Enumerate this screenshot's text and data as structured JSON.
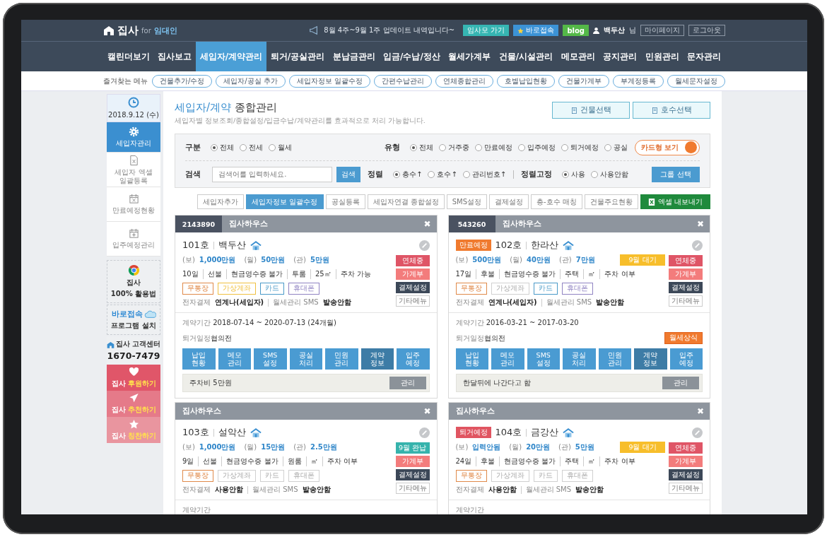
{
  "header": {
    "logo": "집사",
    "logo_for": "for",
    "logo_sub": "임대인",
    "notice": "8월 4주~9월 1주 업데이트 내역입니다~",
    "links": [
      {
        "label": "임사모 가기",
        "kind": "teal"
      },
      {
        "label": "바로접속",
        "kind": "star"
      },
      {
        "label": "blog",
        "kind": "blog"
      }
    ],
    "user": "백두산",
    "user_suffix": "님",
    "account_links": [
      "마이페이지",
      "로그아웃"
    ]
  },
  "nav": [
    {
      "label": "캘린더보기",
      "selected": false
    },
    {
      "label": "집사보고",
      "selected": false
    },
    {
      "label": "세입자/계약관리",
      "selected": true
    },
    {
      "label": "퇴거/공실관리",
      "selected": false
    },
    {
      "label": "분납금관리",
      "selected": false
    },
    {
      "label": "입금/수납/정산",
      "selected": false
    },
    {
      "label": "월세가계부",
      "selected": false
    },
    {
      "label": "건물/시설관리",
      "selected": false
    },
    {
      "label": "메모관리",
      "selected": false
    },
    {
      "label": "공지관리",
      "selected": false
    },
    {
      "label": "민원관리",
      "selected": false
    },
    {
      "label": "문자관리",
      "selected": false
    }
  ],
  "favorites": {
    "label": "즐겨찾는 메뉴",
    "items": [
      "건물추가/수정",
      "세입자/공실 추가",
      "세입자정보 일괄수정",
      "간편수납관리",
      "연체종합관리",
      "호별납입현황",
      "건물가계부",
      "부계정등록",
      "월세문자설정"
    ]
  },
  "sidebar": {
    "date": "2018.9.12 (수)",
    "menu": [
      {
        "label": "세입자관리",
        "kind": "gear",
        "selected": true
      },
      {
        "label": "세입자 엑셀 일괄등록",
        "kind": "excel",
        "selected": false
      },
      {
        "label": "만료예정현황",
        "kind": "cal-x",
        "selected": false
      },
      {
        "label": "입주예정관리",
        "kind": "cal-plus",
        "selected": false
      }
    ],
    "guide": {
      "title": "집사",
      "subtitle": "100% 활용법"
    },
    "install": {
      "title": "바로접속",
      "subtitle": "프로그램 설치"
    },
    "support": {
      "title": "집사 고객센터",
      "phone": "1670-7479"
    },
    "actions": [
      {
        "prefix": "집사",
        "label": "후원하기",
        "kind": "heart"
      },
      {
        "prefix": "집사",
        "label": "추천하기",
        "kind": "plane"
      },
      {
        "prefix": "집사",
        "label": "칭찬하기",
        "kind": "star"
      }
    ]
  },
  "page": {
    "title": "세입자/계약",
    "title_rest": "종합관리",
    "subtitle": "세입자별 정보조회/종합설정/입금수납/계약관리를 효과적으로 처리 가능합니다.",
    "top_buttons": [
      "건물선택",
      "호수선택"
    ]
  },
  "filters": {
    "division": {
      "label": "구분",
      "options": [
        {
          "label": "전체",
          "selected": true
        },
        {
          "label": "전세",
          "selected": false
        },
        {
          "label": "월세",
          "selected": false
        }
      ]
    },
    "type": {
      "label": "유형",
      "options": [
        {
          "label": "전체",
          "selected": true
        },
        {
          "label": "거주중",
          "selected": false
        },
        {
          "label": "만료예정",
          "selected": false
        },
        {
          "label": "입주예정",
          "selected": false
        },
        {
          "label": "퇴거예정",
          "selected": false
        },
        {
          "label": "공실",
          "selected": false
        }
      ]
    },
    "view_toggle": {
      "label": "카드형 보기",
      "on": true
    },
    "search": {
      "label": "검색",
      "placeholder": "검색어를 입력하세요.",
      "button": "검색"
    },
    "sort": {
      "label": "정렬",
      "options": [
        {
          "label": "층수↑",
          "selected": true
        },
        {
          "label": "호수↑",
          "selected": false
        },
        {
          "label": "관리번호↑",
          "selected": false
        }
      ]
    },
    "sort_fixed": {
      "label": "정렬고정",
      "options": [
        {
          "label": "사용",
          "selected": true
        },
        {
          "label": "사용안함",
          "selected": false
        }
      ]
    },
    "group_button": "그룹 선택"
  },
  "toolbar": [
    {
      "label": "세입자추가",
      "kind": "plain"
    },
    {
      "label": "세입자정보 일괄수정",
      "kind": "primary"
    },
    {
      "label": "공실등록",
      "kind": "plain"
    },
    {
      "label": "세입자연결 종합설정",
      "kind": "plain"
    },
    {
      "label": "SMS설정",
      "kind": "plain"
    },
    {
      "label": "결제설정",
      "kind": "plain"
    },
    {
      "label": "층-호수 매칭",
      "kind": "plain"
    },
    {
      "label": "건물주요현황",
      "kind": "plain"
    },
    {
      "label": "엑셀 내보내기",
      "kind": "excel"
    }
  ],
  "cards": [
    {
      "id": "2143890",
      "building": "집사하우스",
      "close": "✖",
      "unit": "101호",
      "tenant": "백두산",
      "money": [
        {
          "label": "(보)",
          "value": "1,000만원"
        },
        {
          "label": "(월)",
          "value": "50만원"
        },
        {
          "label": "(관)",
          "value": "5만원"
        }
      ],
      "details": [
        "10일",
        "선불",
        "현금영수증 불가",
        "투룸",
        "25㎡",
        "주차 가능"
      ],
      "pay_methods": [
        {
          "label": "무통장",
          "on": true,
          "color": "#e08a4a"
        },
        {
          "label": "가상계좌",
          "on": true,
          "color": "#f0c040"
        },
        {
          "label": "카드",
          "on": true,
          "color": "#4a9ac8"
        },
        {
          "label": "휴대폰",
          "on": true,
          "color": "#9083c2"
        }
      ],
      "epay": {
        "label": "전자결제",
        "value": "연계나(세입자)",
        "sms_label": "월세관리 SMS",
        "sms_value": "발송안함"
      },
      "side_buttons": [
        {
          "label": "연체중",
          "kind": "overdue"
        },
        {
          "label": "가계부",
          "kind": "ledger"
        },
        {
          "label": "결제설정",
          "kind": "settings"
        },
        {
          "label": "기타메뉴",
          "kind": "etc"
        }
      ],
      "contract": {
        "label": "계약기간",
        "value": "2018-07-14 ~ 2020-07-13 (24개월)"
      },
      "moveout": {
        "label": "퇴거일정",
        "value": "협의전"
      },
      "tabs": [
        {
          "label": "납입\n현황",
          "selected": false
        },
        {
          "label": "메모\n관리",
          "selected": false
        },
        {
          "label": "SMS\n설정",
          "selected": false
        },
        {
          "label": "공실\n처리",
          "selected": false
        },
        {
          "label": "민원\n관리",
          "selected": false
        },
        {
          "label": "계약\n정보",
          "selected": true
        },
        {
          "label": "입주\n예정",
          "selected": false
        }
      ],
      "memo": {
        "text": "주차비 5만원",
        "button": "관리"
      }
    },
    {
      "id": "543260",
      "building": "집사하우스",
      "close": "✖",
      "status": {
        "label": "만료예정",
        "color": "#f07a2e"
      },
      "unit": "102호",
      "tenant": "한라산",
      "money": [
        {
          "label": "(보)",
          "value": "500만원"
        },
        {
          "label": "(월)",
          "value": "40만원"
        },
        {
          "label": "(관)",
          "value": "7만원"
        }
      ],
      "badges": [
        {
          "label": "9월 대기",
          "kind": "waiting"
        }
      ],
      "details": [
        "17일",
        "후불",
        "현금영수증 불가",
        "주택",
        "㎡",
        "주차 여부"
      ],
      "pay_methods": [
        {
          "label": "무통장",
          "on": true,
          "color": "#e08a4a"
        },
        {
          "label": "가상계좌",
          "on": false
        },
        {
          "label": "카드",
          "on": true,
          "color": "#4a9ac8"
        },
        {
          "label": "휴대폰",
          "on": true,
          "color": "#9083c2"
        }
      ],
      "epay": {
        "label": "전자결제",
        "value": "연계나(세입자)",
        "sms_label": "월세관리 SMS",
        "sms_value": "발송안함"
      },
      "side_buttons": [
        {
          "label": "연체중",
          "kind": "overdue"
        },
        {
          "label": "가계부",
          "kind": "ledger"
        },
        {
          "label": "결제설정",
          "kind": "settings"
        },
        {
          "label": "기타메뉴",
          "kind": "etc"
        }
      ],
      "contract": {
        "label": "계약기간",
        "value": "2016-03-21 ~ 2017-03-20"
      },
      "moveout": {
        "label": "퇴거일정",
        "value": "협의전",
        "button": "월세상식"
      },
      "tabs": [
        {
          "label": "납입\n현황",
          "selected": false
        },
        {
          "label": "메모\n관리",
          "selected": false
        },
        {
          "label": "SMS\n설정",
          "selected": false
        },
        {
          "label": "공실\n처리",
          "selected": false
        },
        {
          "label": "민원\n관리",
          "selected": false
        },
        {
          "label": "계약\n정보",
          "selected": true
        },
        {
          "label": "입주\n예정",
          "selected": false
        }
      ],
      "memo": {
        "text": "한달뒤에 나간다고 함",
        "button": "관리"
      }
    },
    {
      "building": "집사하우스",
      "close": "✖",
      "unit": "103호",
      "tenant": "설악산",
      "money": [
        {
          "label": "(보)",
          "value": "1,000만원"
        },
        {
          "label": "(월)",
          "value": "15만원"
        },
        {
          "label": "(관)",
          "value": "2.5만원"
        }
      ],
      "details": [
        "9일",
        "선불",
        "현금영수증 불가",
        "원룸",
        "㎡",
        "주차 여부"
      ],
      "pay_methods": [
        {
          "label": "무통장",
          "on": true,
          "color": "#e08a4a"
        },
        {
          "label": "가상계좌",
          "on": false
        },
        {
          "label": "카드",
          "on": false
        },
        {
          "label": "휴대폰",
          "on": false
        }
      ],
      "epay": {
        "label": "전자결제",
        "value": "사용안함",
        "sms_label": "월세관리 SMS",
        "sms_value": "발송안함"
      },
      "side_buttons": [
        {
          "label": "9월 완납",
          "kind": "paid"
        },
        {
          "label": "가계부",
          "kind": "ledger"
        },
        {
          "label": "결제설정",
          "kind": "settings"
        },
        {
          "label": "기타메뉴",
          "kind": "etc"
        }
      ],
      "contract": {
        "label": "계약기간"
      }
    },
    {
      "building": "집사하우스",
      "close": "✖",
      "status": {
        "label": "퇴거예정",
        "color": "#e05561"
      },
      "unit": "104호",
      "tenant": "금강산",
      "money": [
        {
          "label": "(보)",
          "value": "입력안됨"
        },
        {
          "label": "(월)",
          "value": "20만원"
        },
        {
          "label": "(관)",
          "value": "5만원"
        }
      ],
      "badges": [
        {
          "label": "9월 대기",
          "kind": "waiting"
        }
      ],
      "details": [
        "24일",
        "후불",
        "현금영수증 불가",
        "주택",
        "㎡",
        "주차 여부"
      ],
      "pay_methods": [
        {
          "label": "무통장",
          "on": true,
          "color": "#e08a4a"
        },
        {
          "label": "가상계좌",
          "on": false
        },
        {
          "label": "카드",
          "on": false
        },
        {
          "label": "휴대폰",
          "on": false
        }
      ],
      "epay": {
        "label": "전자결제",
        "value": "사용안함",
        "sms_label": "월세관리 SMS",
        "sms_value": "발송안함"
      },
      "side_buttons": [
        {
          "label": "연체중",
          "kind": "overdue"
        },
        {
          "label": "가계부",
          "kind": "ledger"
        },
        {
          "label": "결제설정",
          "kind": "settings"
        },
        {
          "label": "기타메뉴",
          "kind": "etc"
        }
      ],
      "contract": {
        "label": "계약기간"
      }
    }
  ]
}
